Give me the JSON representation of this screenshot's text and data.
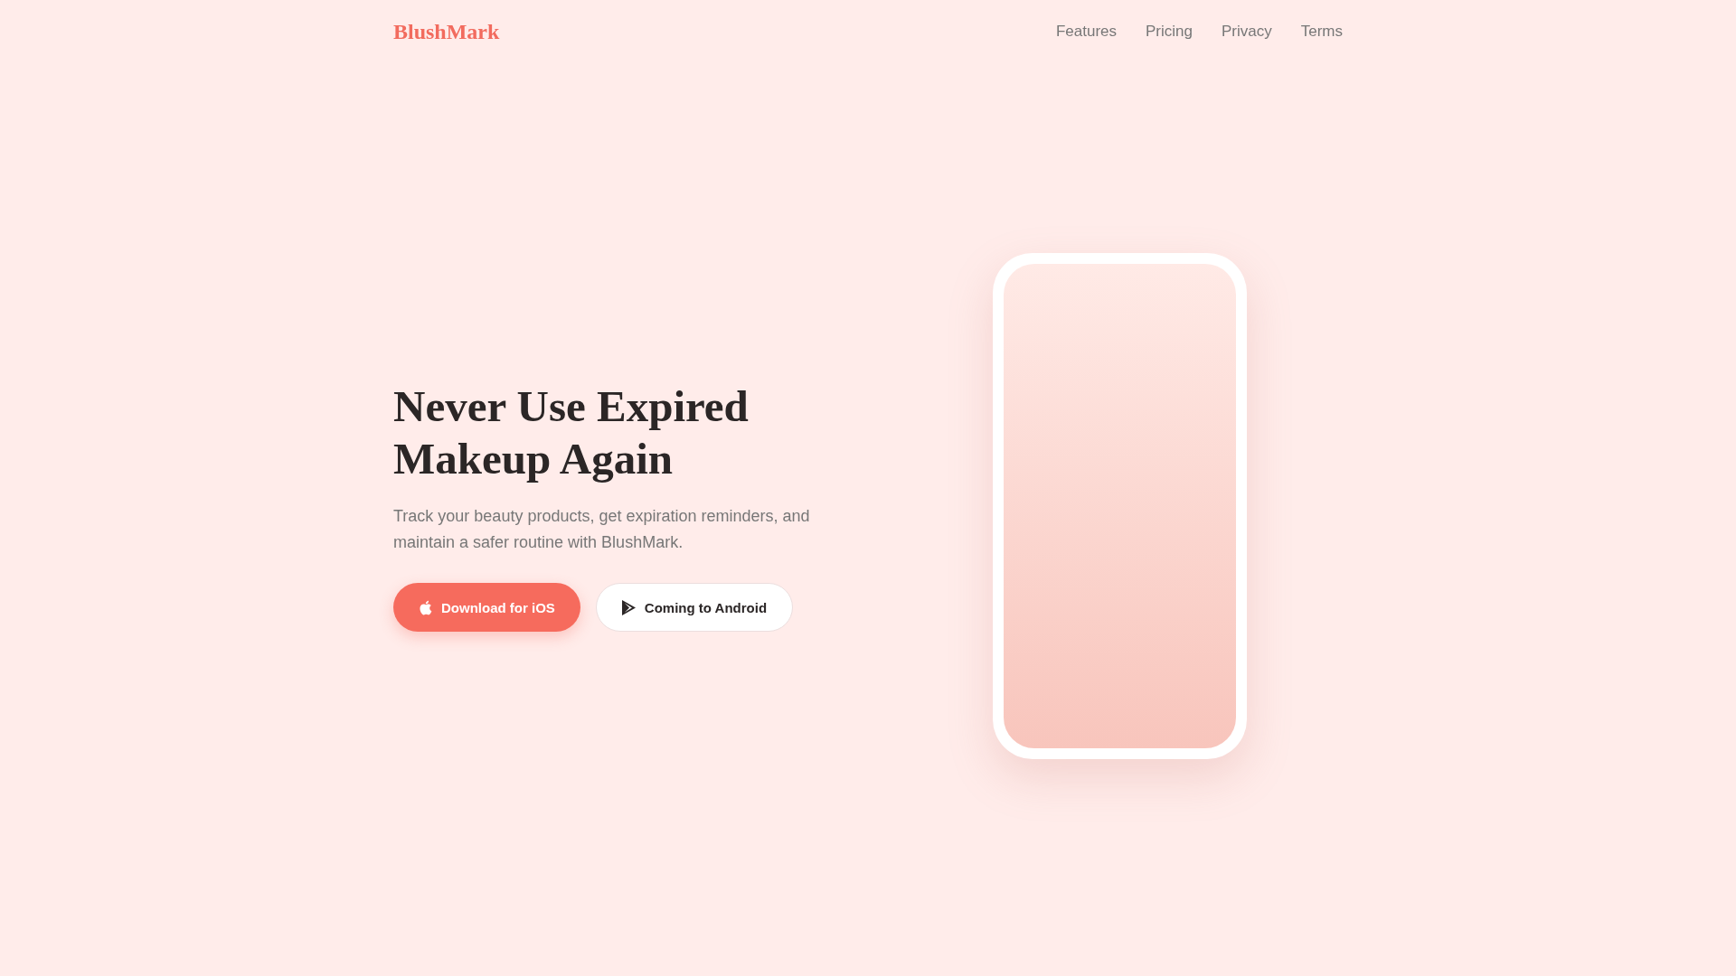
{
  "header": {
    "logo": "BlushMark",
    "nav": [
      "Features",
      "Pricing",
      "Privacy",
      "Terms"
    ]
  },
  "hero": {
    "title": "Never Use Expired Makeup Again",
    "subtitle": "Track your beauty products, get expiration reminders, and maintain a safer routine with BlushMark.",
    "buttons": [
      {
        "label": "Download for iOS",
        "kind": "primary"
      },
      {
        "label": "Coming to Android",
        "kind": "secondary"
      }
    ]
  }
}
